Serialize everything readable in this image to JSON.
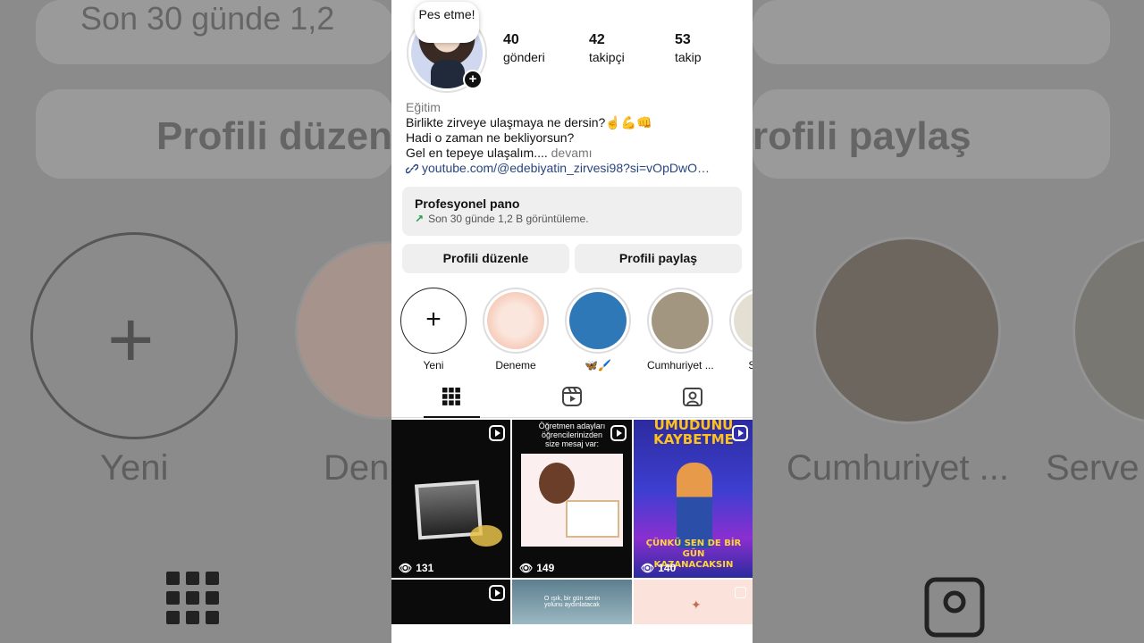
{
  "note": "Pes etme!",
  "stats": [
    {
      "num": "40",
      "label": "gönderi"
    },
    {
      "num": "42",
      "label": "takipçi"
    },
    {
      "num": "53",
      "label": "takip"
    }
  ],
  "bio": {
    "category": "Eğitim",
    "line1": "Birlikte zirveye ulaşmaya ne dersin?☝️💪👊",
    "line2": "Hadi o zaman ne bekliyorsun?",
    "line3": "Gel en tepeye ulaşalım.... ",
    "more": "devamı",
    "link": "youtube.com/@edebiyatin_zirvesi98?si=vOpDwO…"
  },
  "dashboard": {
    "title": "Profesyonel pano",
    "subtitle": "Son 30 günde 1,2 B görüntüleme."
  },
  "actions": {
    "edit": "Profili düzenle",
    "share": "Profili paylaş"
  },
  "highlights": [
    {
      "label": "Yeni"
    },
    {
      "label": "Deneme"
    },
    {
      "label": "🦋🖌️"
    },
    {
      "label": "Cumhuriyet ..."
    },
    {
      "label": "Serve"
    }
  ],
  "posts": [
    {
      "views": "131"
    },
    {
      "views": "149",
      "caption": "Öğretmen adayları öğrencilerinizden size mesaj var:"
    },
    {
      "views": "140",
      "headline": "UMUDUNU KAYBETME",
      "footer": "ÇÜNKÜ SEN DE BİR GÜN KAZANACAKSIN"
    },
    {},
    {
      "caption": "O ışık, bir gün senin yolunu aydınlatacak"
    },
    {}
  ],
  "background": {
    "top": "Son 30 günde 1,2",
    "left": "Profili düzen",
    "right": "rofili paylaş",
    "yeni": "Yeni",
    "den": "Den",
    "cumhuriyet": "Cumhuriyet ...",
    "serve": "Serve"
  }
}
